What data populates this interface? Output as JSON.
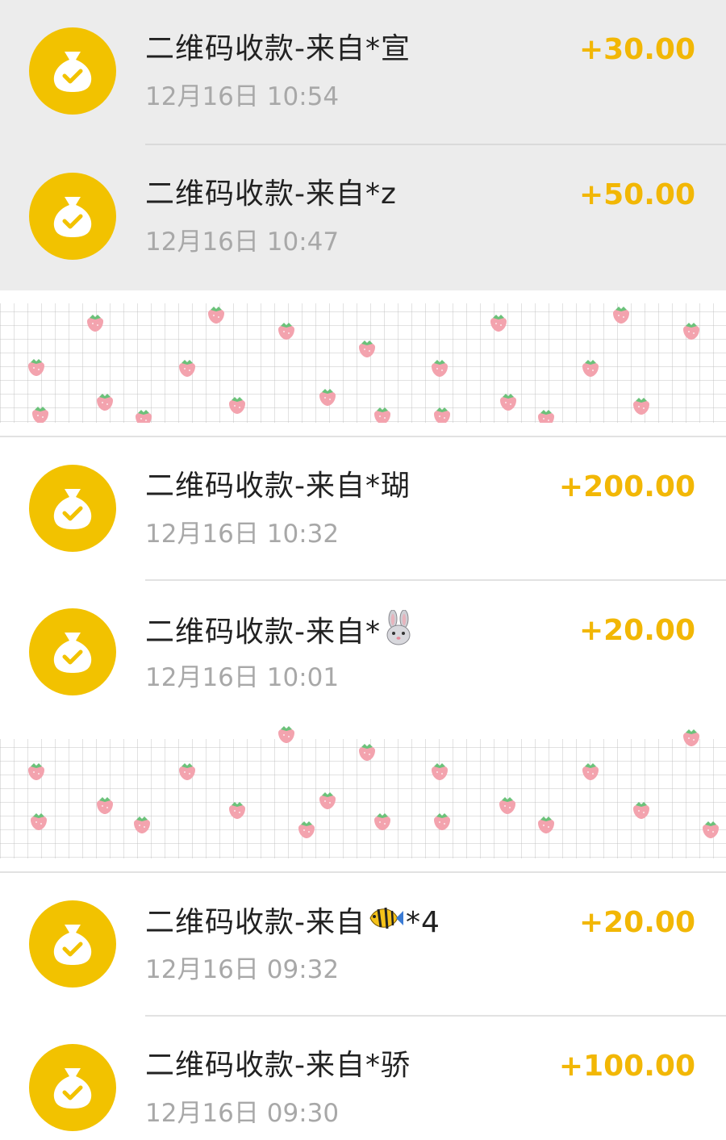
{
  "transactions": [
    {
      "title": "二维码收款-来自*宣",
      "time": "12月16日 10:54",
      "amount": "+30.00",
      "highlighted": true,
      "icon": "money-bag-check-icon"
    },
    {
      "title": "二维码收款-来自*z",
      "time": "12月16日 10:47",
      "amount": "+50.00",
      "highlighted": true,
      "icon": "money-bag-check-icon"
    },
    {
      "title": "二维码收款-来自*瑚",
      "time": "12月16日 10:32",
      "amount": "+200.00",
      "highlighted": false,
      "icon": "money-bag-check-icon"
    },
    {
      "title_prefix": "二维码收款-来自*",
      "title_emoji": "rabbit-emoji",
      "time": "12月16日 10:01",
      "amount": "+20.00",
      "highlighted": false,
      "icon": "money-bag-check-icon"
    },
    {
      "title_prefix": "二维码收款-来自",
      "title_emoji": "fish-emoji",
      "title_suffix": "*4",
      "time": "12月16日 09:32",
      "amount": "+20.00",
      "highlighted": false,
      "icon": "money-bag-check-icon"
    },
    {
      "title": "二维码收款-来自*骄",
      "time": "12月16日 09:30",
      "amount": "+100.00",
      "highlighted": false,
      "icon": "money-bag-check-icon"
    }
  ],
  "colors": {
    "icon_background": "#F2C200",
    "amount": "#F2B705",
    "highlight_row": "#ECECEC",
    "time_text": "#A8A8A8",
    "title_text": "#222222",
    "strawberry": "#F3A3AE",
    "strawberry_leaf": "#6BC27A"
  },
  "decorations": {
    "banner_pattern": "strawberry-grid-pattern"
  }
}
